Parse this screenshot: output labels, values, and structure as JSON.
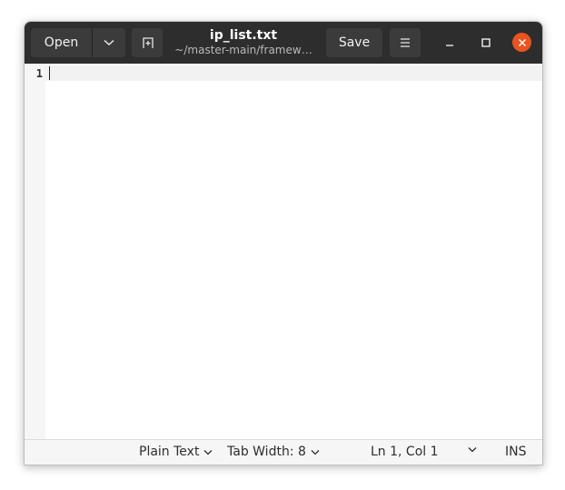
{
  "header": {
    "open_label": "Open",
    "save_label": "Save",
    "title": "ip_list.txt",
    "subtitle": "~/master-main/framew…"
  },
  "editor": {
    "line_numbers": [
      "1"
    ]
  },
  "statusbar": {
    "language": "Plain Text",
    "tab_width": "Tab Width: 8",
    "cursor_position": "Ln 1, Col 1",
    "insert_mode": "INS"
  },
  "colors": {
    "headerbar": "#2d2d2d",
    "button": "#3b3b3b",
    "close": "#e95420"
  }
}
